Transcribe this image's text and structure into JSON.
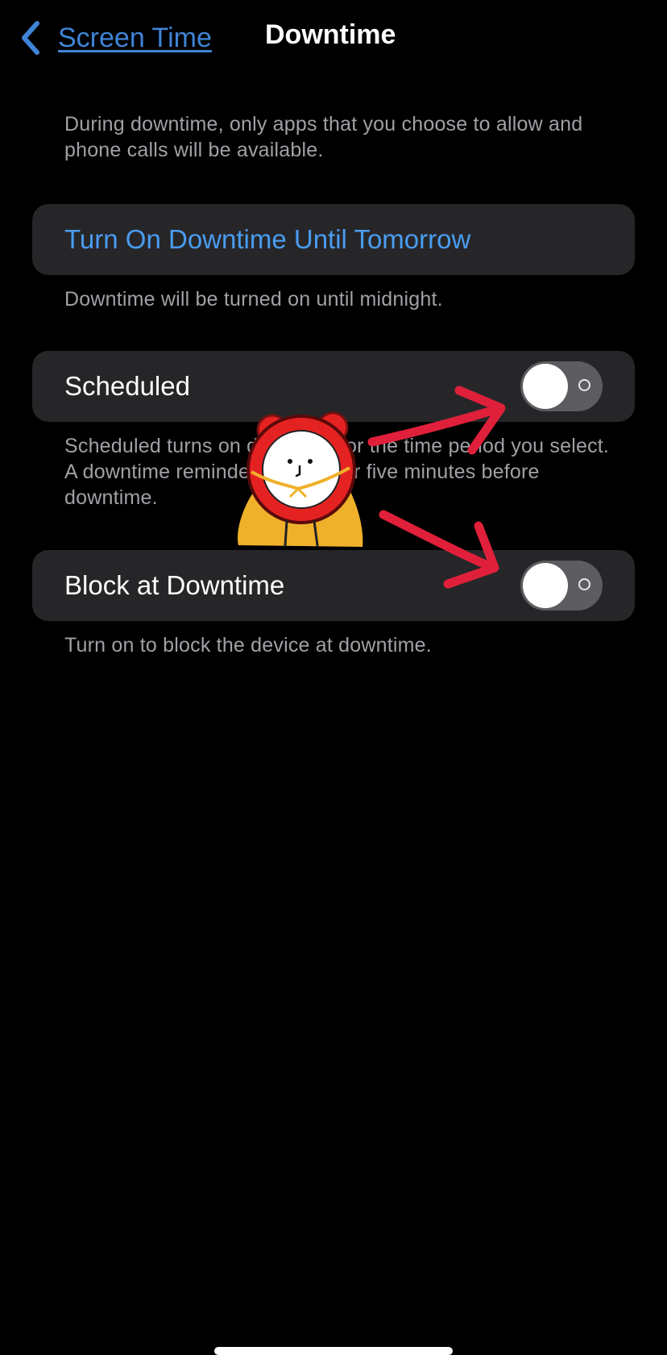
{
  "nav": {
    "back_label": "Screen Time",
    "title": "Downtime"
  },
  "intro_text": "During downtime, only apps that you choose to allow and phone calls will be available.",
  "turn_on": {
    "label": "Turn On Downtime Until Tomorrow",
    "footnote": "Downtime will be turned on until midnight."
  },
  "scheduled": {
    "label": "Scheduled",
    "enabled": false,
    "footnote": "Scheduled turns on downtime for the time period you select. A downtime reminder will appear five minutes before downtime."
  },
  "block_at_downtime": {
    "label": "Block at Downtime",
    "enabled": false,
    "footnote": "Turn on to block the device at downtime."
  },
  "colors": {
    "accent": "#4a9cf0",
    "cell_background": "#262629",
    "secondary_text": "#a0a0a6",
    "toggle_off": "#5c5c61",
    "annotation_arrow": "#e0203a"
  },
  "icons": {
    "back": "chevron-left-icon",
    "sticker": "alarm-clock-character-sticker",
    "arrows": "red-hand-drawn-arrow"
  }
}
